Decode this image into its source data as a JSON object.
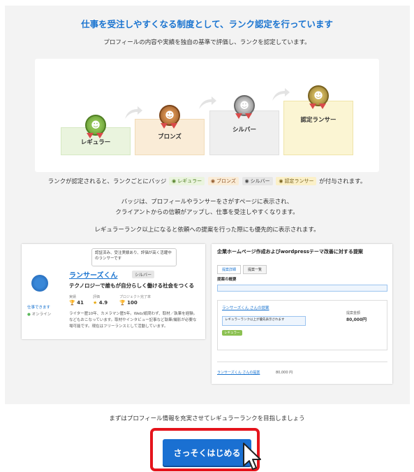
{
  "heading": "仕事を受注しやすくなる制度として、ランク認定を行っています",
  "subheading": "プロフィールの内容や実績を独自の基準で評価し、ランクを認定しています。",
  "ranks": [
    {
      "label": "レギュラー",
      "color": "#6fa43a"
    },
    {
      "label": "ブロンズ",
      "color": "#b87337"
    },
    {
      "label": "シルバー",
      "color": "#9a9a9a"
    },
    {
      "label": "認定ランサー",
      "color": "#b19130"
    }
  ],
  "badge_sentence": {
    "before": "ランクが認定されると、ランクごとにバッジ",
    "badges": [
      "レギュラー",
      "ブロンズ",
      "シルバー",
      "認定ランサー"
    ],
    "after": "が付与されます。"
  },
  "para1": {
    "line1": "バッジは、プロフィールやランサーをさがすページに表示され、",
    "line2": "クライアントからの信頼がアップし、仕事を受注しやすくなります。"
  },
  "para2": "レギュラーランク以上になると依頼への提案を行った際にも優先的に表示されます。",
  "profile_example": {
    "tooltip": "認証済み、受注実績あり、評価が高く活躍中のランサーです",
    "name": "ランサーズくん",
    "badge": "シルバー",
    "tagline": "テクノロジーで誰もが自分らしく働ける社会をつくる",
    "status_left": "仕事できます",
    "online": "オンライン",
    "stat_labels": [
      "実績",
      "評価",
      "プロジェクト完了率"
    ],
    "stats": [
      "41",
      "4.9",
      "100"
    ],
    "bio": "ライター歴10年、カメラマン歴5年。Web/紙問わず、取材／執筆を経験。などもおこなっています。取材やインタビュー記事など執筆/撮影が必要な場可能です。現在はフリーランスとして活動しています。"
  },
  "proposal_example": {
    "title": "企業ホームページ作成およびwordpressテーマ改善に対する提案",
    "tabs": [
      "提案詳細",
      "提案一覧"
    ],
    "section": "提案の概要",
    "lancer": "ランサーズくん さんの提案",
    "highlight": "レギュラーランク以上が優先表示されます",
    "price_label": "提案金額",
    "price": "80,000円",
    "footer_name": "ランサーズくん さんの提案",
    "footer_price": "80,000 円"
  },
  "bottom_text": "まずはプロフィール情報を充実させてレギュラーランクを目指しましょう",
  "cta_label": "さっそくはじめる",
  "colors": {
    "accent": "#1a74d0",
    "cta": "#1a70d2",
    "outline": "#e5141c",
    "panel": "#f3f3f3"
  }
}
